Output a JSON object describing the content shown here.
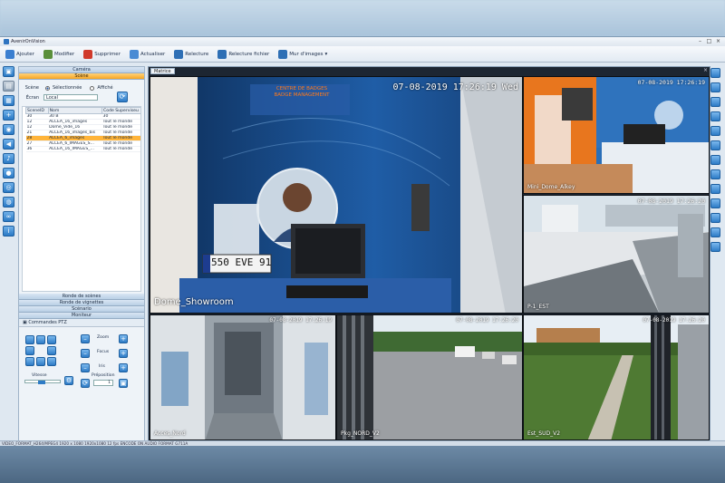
{
  "app": {
    "title": "AvenirOnVision"
  },
  "toolbar": {
    "items": [
      {
        "label": "Ajouter",
        "icon": "add-icon",
        "color": "#3b7fd0"
      },
      {
        "label": "Modifier",
        "icon": "edit-icon",
        "color": "#5a8f3a"
      },
      {
        "label": "Supprimer",
        "icon": "delete-icon",
        "color": "#d03a2b"
      },
      {
        "label": "Actualiser",
        "icon": "refresh-icon",
        "color": "#4a8bd4"
      },
      {
        "label": "Relecture",
        "icon": "playback-icon",
        "color": "#2e6fb5"
      },
      {
        "label": "Relecture fichier",
        "icon": "file-playback-icon",
        "color": "#2e6fb5"
      },
      {
        "label": "Mur d'images",
        "icon": "video-wall-icon",
        "color": "#2e6fb5"
      }
    ]
  },
  "panel": {
    "camera_header": "Caméra",
    "scene_header": "Scène",
    "scene_label": "Scène",
    "radio_selected": "Sélectionnée",
    "radio_displayed": "Affiché",
    "screen_label": "Écran",
    "screen_value": "Local",
    "table": {
      "headers": [
        "SceneID",
        "Nom",
        "Code Superviseu"
      ],
      "rows": [
        [
          "30",
          "30 B",
          "30"
        ],
        [
          "12",
          "ALCEA_16_images",
          "Tout le monde"
        ],
        [
          "12",
          "Dome_Vide_16",
          "Tout le monde"
        ],
        [
          "21",
          "ALCEA_16_images_bis",
          "Tout le monde"
        ],
        [
          "28",
          "ALCEA_6_images",
          "Tout le monde"
        ],
        [
          "27",
          "ALCEA_6_IMAGES_S...",
          "Tout le monde"
        ],
        [
          "36",
          "ALCEA_16_IMAGES_...",
          "Tout le monde"
        ]
      ],
      "selected_index": 4
    },
    "sections": [
      "Ronde de scènes",
      "Ronde de vignettes",
      "Scénario",
      "Moniteur"
    ],
    "ptz_title": "Commandes PTZ",
    "zoom_label": "Zoom",
    "focus_label": "Focus",
    "iris_label": "Iris",
    "speed_label": "Vitesse",
    "preset_label": "Préposition",
    "preset_value": "1"
  },
  "matrix": {
    "tab_label": "Matrice",
    "close_symbol": "×",
    "cams": [
      {
        "name": "Dome_Showroom",
        "time": "07-08-2019 17:26:19 Wed"
      },
      {
        "name": "Mini_Dome_Alkey",
        "time": "07-08-2019 17:26:19"
      },
      {
        "name": "P-1_EST",
        "time": "07-08-2019 17:26:20"
      },
      {
        "name": "Acces_Nord",
        "time": "07-08-2019 17:26:19"
      },
      {
        "name": "Pkg_NORD_V2",
        "time": "07-08-2019 17:26:20"
      },
      {
        "name": "Est_SUD_V2",
        "time": "07-08-2019 17:26:20"
      }
    ],
    "showroom_sign": "CENTRE DE BADGES\nBADGE MANAGEMENT",
    "plate": "550 EVE 91",
    "colors": {
      "orange_wall": "#e8761e",
      "blue_wall": "#2a6fb8",
      "sky": "#dfe8ef",
      "grass": "#4f7a33"
    }
  },
  "status": {
    "text": "VIDEO_FORMAT_H264/MPEG4   1920 x 1080 1920x1080   12 fps   ENCODE ON   AUDIO FORMAT G711A"
  }
}
